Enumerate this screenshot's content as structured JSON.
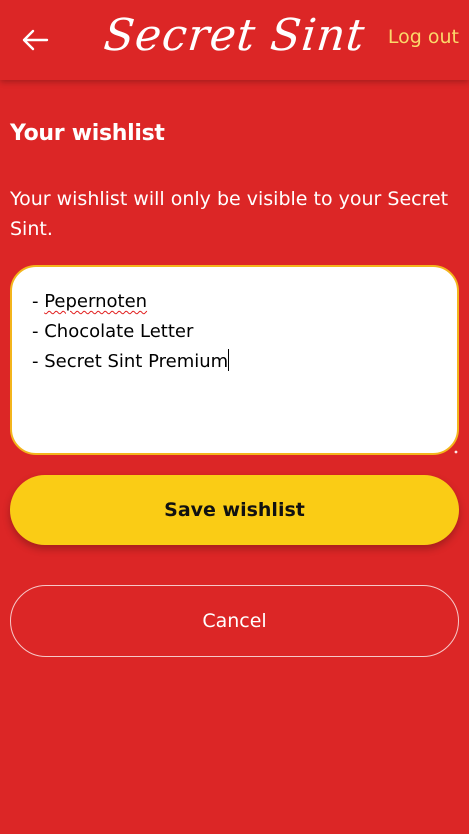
{
  "header": {
    "logo_text": "Secret Sint",
    "logout_label": "Log out",
    "back_icon": "arrow-left-icon"
  },
  "page": {
    "title": "Your wishlist",
    "description": "Your wishlist will only be visible to your Secret Sint."
  },
  "wishlist": {
    "lines": [
      "- Pepernoten",
      "- Chocolate Letter",
      "- Secret Sint Premium"
    ],
    "prefix": "- ",
    "misspelled_word": "Pepernoten"
  },
  "actions": {
    "save_label": "Save wishlist",
    "cancel_label": "Cancel"
  },
  "colors": {
    "background": "#dc2626",
    "accent": "#facc15",
    "logout_text": "#fbd96b",
    "input_border": "#f3b51c"
  }
}
